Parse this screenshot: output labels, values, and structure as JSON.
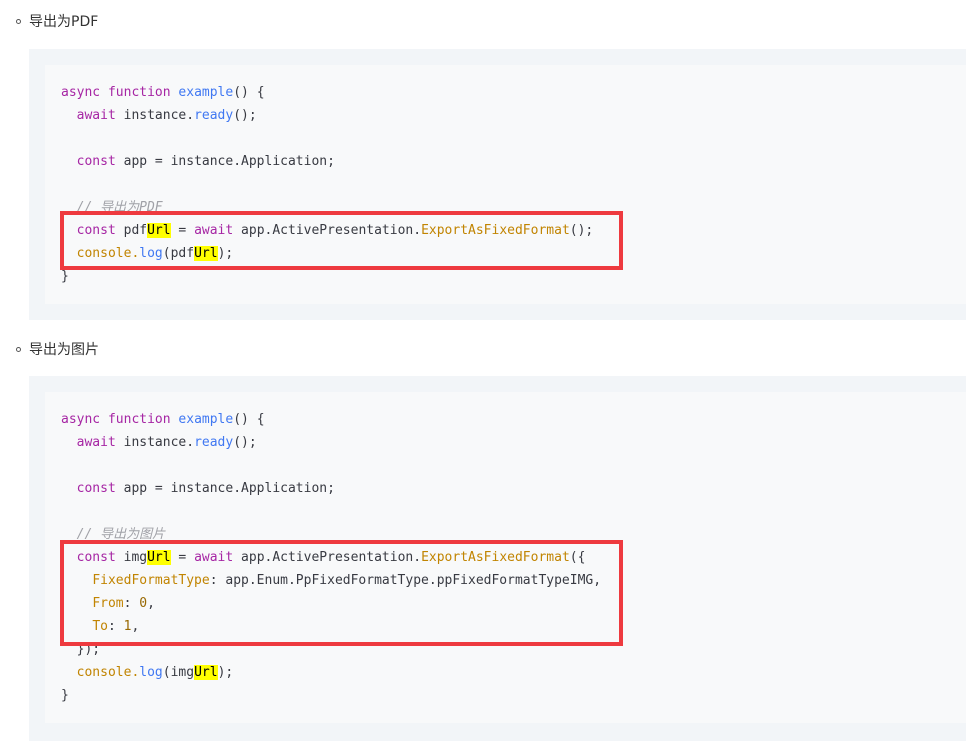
{
  "section_pdf": {
    "heading": "导出为PDF",
    "lines": {
      "l1_kw": "async",
      "l1_kw2": "function",
      "l1_fn": "example",
      "l1_rest": "() {",
      "l2_kw": "await",
      "l2_mid": " instance.",
      "l2_fn": "ready",
      "l2_end": "();",
      "l3_kw": "const",
      "l3_rest": " app = instance.Application;",
      "l4_comment": "// 导出为PDF",
      "l5_kw": "const",
      "l5_a": " pdf",
      "l5_hl": "Url",
      "l5_b": " = ",
      "l5_kw2": "await",
      "l5_c": " app.ActivePresentation.",
      "l5_fn": "ExportAsFixedFormat",
      "l5_end": "();",
      "l6_a": "console.",
      "l6_fn": "log",
      "l6_b": "(pdf",
      "l6_hl": "Url",
      "l6_end": ");",
      "l7": "}"
    }
  },
  "section_img": {
    "heading": "导出为图片",
    "lines": {
      "l1_kw": "async",
      "l1_kw2": "function",
      "l1_fn": "example",
      "l1_rest": "() {",
      "l2_kw": "await",
      "l2_mid": " instance.",
      "l2_fn": "ready",
      "l2_end": "();",
      "l3_kw": "const",
      "l3_rest": " app = instance.Application;",
      "l4_comment": "// 导出为图片",
      "l5_kw": "const",
      "l5_a": " img",
      "l5_hl": "Url",
      "l5_b": " = ",
      "l5_kw2": "await",
      "l5_c": " app.ActivePresentation.",
      "l5_fn": "ExportAsFixedFormat",
      "l5_end": "({",
      "l6_prop": "FixedFormatType",
      "l6_rest": ": app.Enum.PpFixedFormatType.ppFixedFormatTypeIMG,",
      "l7_prop": "From",
      "l7_colon": ": ",
      "l7_num": "0",
      "l7_end": ",",
      "l8_prop": "To",
      "l8_colon": ": ",
      "l8_num": "1",
      "l8_end": ",",
      "l9": "});",
      "l10_a": "console.",
      "l10_fn": "log",
      "l10_b": "(img",
      "l10_hl": "Url",
      "l10_end": ");",
      "l11": "}"
    }
  },
  "colors": {
    "keyword": "#a626a4",
    "function": "#4078f2",
    "property": "#c18401",
    "number": "#986801",
    "highlight": "#ffff00",
    "annotation_box": "#ee3a3f"
  }
}
